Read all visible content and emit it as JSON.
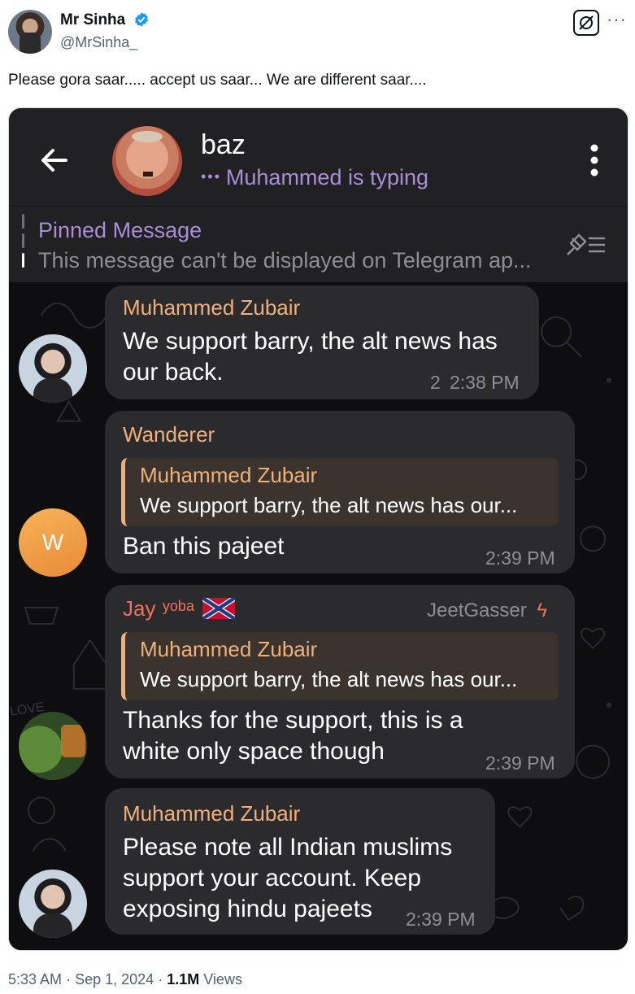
{
  "tweet": {
    "author_name": "Mr Sinha",
    "author_handle": "@MrSinha_",
    "text": "Please gora saar..... accept us saar... We are different saar....",
    "time": "5:33 AM",
    "separator": "·",
    "date": "Sep 1, 2024",
    "views_count": "1.1M",
    "views_label": "Views",
    "more_glyph": "···",
    "icons": [
      "verified-badge-icon",
      "grok-icon",
      "more-icon"
    ]
  },
  "telegram": {
    "chat_name": "baz",
    "typing_dots": "•••",
    "typing_status": "Muhammed is typing",
    "pinned_title": "Pinned Message",
    "pinned_text": "This message can't be displayed on Telegram ap...",
    "colors": {
      "header_bg": "#212124",
      "accent_purple": "#a88fd6",
      "sender_orange": "#f0b07a",
      "bubble_bg": "#2b2b2e",
      "chat_bg": "#0e0e10"
    },
    "messages": [
      {
        "sender": "Muhammed Zubair",
        "lines": [
          "We support barry, the alt news has",
          "our back."
        ],
        "reply_count": "2",
        "time": "2:38 PM"
      },
      {
        "sender": "Wanderer",
        "avatar_letter": "W",
        "quote_sender": "Muhammed Zubair",
        "quote_text": "We support barry, the alt news has our...",
        "lines": [
          "Ban this pajeet"
        ],
        "time": "2:39 PM"
      },
      {
        "sender": "Jay",
        "sender_suffix": "yoba",
        "tag": "JeetGasser",
        "quote_sender": "Muhammed Zubair",
        "quote_text": "We support barry, the alt news has our...",
        "lines": [
          "Thanks for the support, this is a",
          "white only space though"
        ],
        "time": "2:39 PM"
      },
      {
        "sender": "Muhammed Zubair",
        "lines": [
          "Please note all Indian muslims",
          "support your account. Keep",
          "exposing hindu pajeets"
        ],
        "time": "2:39 PM"
      }
    ]
  }
}
